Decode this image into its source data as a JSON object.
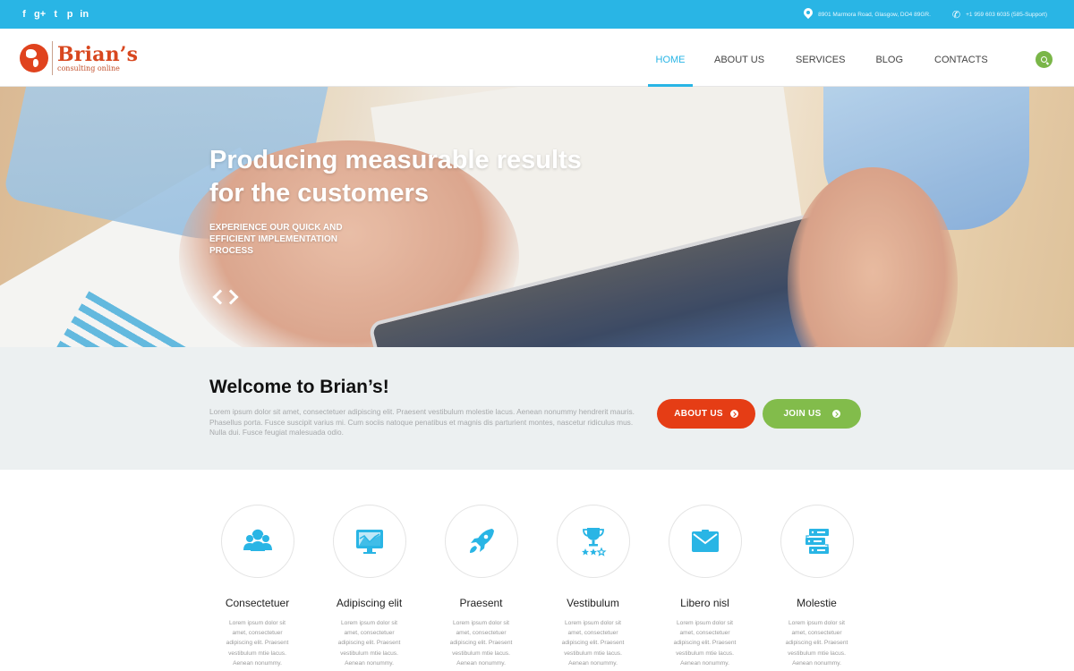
{
  "topbar": {
    "social": [
      {
        "icon": "facebook-icon",
        "glyph": "f"
      },
      {
        "icon": "google-plus-icon",
        "glyph": "g+"
      },
      {
        "icon": "twitter-icon",
        "glyph": "t"
      },
      {
        "icon": "pinterest-icon",
        "glyph": "p"
      },
      {
        "icon": "linkedin-icon",
        "glyph": "in"
      }
    ],
    "address": "8901 Marmora Road, Glasgow, DO4 89GR.",
    "phone": "+1 959 603 6035 (585-Support)",
    "color": "#29b5e5"
  },
  "header": {
    "logo_name": "Brian’s",
    "logo_tagline": "consulting online",
    "nav": [
      {
        "label": "Home",
        "active": true
      },
      {
        "label": "About us",
        "active": false
      },
      {
        "label": "Services",
        "active": false
      },
      {
        "label": "Blog",
        "active": false
      },
      {
        "label": "Contacts",
        "active": false
      }
    ],
    "search_icon": "search-icon"
  },
  "hero": {
    "title": "Producing measurable results for the customers",
    "subtitle": "Experience our quick and efficient implementation process"
  },
  "welcome": {
    "title": "Welcome to Brian’s!",
    "text": "Lorem ipsum dolor sit amet, consectetuer adipiscing elit. Praesent vestibulum molestie lacus. Aenean nonummy hendrerit mauris. Phasellus porta. Fusce suscipit varius mi. Cum sociis natoque penatibus et magnis dis parturient montes, nascetur ridiculus mus. Nulla dui. Fusce feugiat malesuada odio.",
    "about_button": "About us",
    "join_button": "Join us",
    "about_color": "#e53d15",
    "join_color": "#82bc4b"
  },
  "features": [
    {
      "icon": "support-team-icon",
      "title": "Consectetuer",
      "text": "Lorem ipsum dolor sit amet, consectetuer adipiscing elit. Praesent vestibulum mtie lacus. Aenean nonummy."
    },
    {
      "icon": "monitor-chart-icon",
      "title": "Adipiscing elit",
      "text": "Lorem ipsum dolor sit amet, consectetuer adipiscing elit. Praesent vestibulum mtie lacus. Aenean nonummy."
    },
    {
      "icon": "rocket-icon",
      "title": "Praesent",
      "text": "Lorem ipsum dolor sit amet, consectetuer adipiscing elit. Praesent vestibulum mtie lacus. Aenean nonummy."
    },
    {
      "icon": "trophy-icon",
      "title": "Vestibulum",
      "text": "Lorem ipsum dolor sit amet, consectetuer adipiscing elit. Praesent vestibulum mtie lacus. Aenean nonummy."
    },
    {
      "icon": "mail-icon",
      "title": "Libero nisl",
      "text": "Lorem ipsum dolor sit amet, consectetuer adipiscing elit. Praesent vestibulum mtie lacus. Aenean nonummy."
    },
    {
      "icon": "server-icon",
      "title": "Molestie",
      "text": "Lorem ipsum dolor sit amet, consectetuer adipiscing elit. Praesent vestibulum mtie lacus. Aenean nonummy."
    }
  ],
  "accent_color": "#29b5e5"
}
